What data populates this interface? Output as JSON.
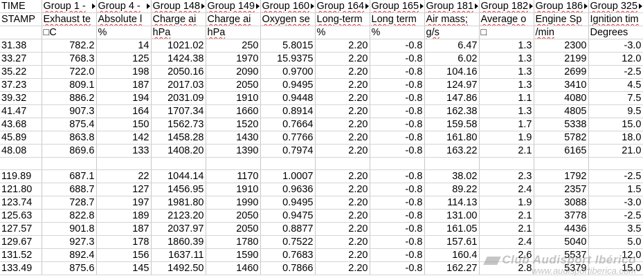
{
  "sheet": {
    "header_row1": [
      "TIME",
      "Group 1 -",
      "Group 4 -",
      "Group 148",
      "Group 149",
      "Group 160",
      "Group 164",
      "Group 165",
      "Group 181",
      "Group 182",
      "Group 186",
      "Group 325"
    ],
    "header_row2": [
      "STAMP",
      "Exhaust te",
      "Absolute l",
      "Charge ai",
      "Charge ai",
      "Oxygen se",
      "Long-term",
      "Long term",
      "Air mass;",
      "Average o",
      "Engine Sp",
      "Ignition tim"
    ],
    "units_row": [
      "",
      "□C",
      "%",
      "hPa",
      "hPa",
      "",
      "%",
      "%",
      "g/s",
      "□",
      "/min",
      "Degrees"
    ],
    "rows": [
      [
        "31.38",
        "782.2",
        "14",
        "1021.02",
        "250",
        "5.8015",
        "2.20",
        "-0.8",
        "6.47",
        "1.3",
        "2300",
        "-3.0"
      ],
      [
        "33.27",
        "768.3",
        "125",
        "1424.38",
        "1970",
        "15.9375",
        "2.20",
        "-0.8",
        "6.02",
        "1.3",
        "2199",
        "12.0"
      ],
      [
        "35.22",
        "722.0",
        "198",
        "2050.16",
        "2090",
        "0.9700",
        "2.20",
        "-0.8",
        "104.16",
        "1.3",
        "2699",
        "-2.5"
      ],
      [
        "37.23",
        "809.1",
        "187",
        "2017.03",
        "2050",
        "0.9495",
        "2.20",
        "-0.8",
        "124.97",
        "1.3",
        "3410",
        "4.5"
      ],
      [
        "39.32",
        "886.2",
        "194",
        "2031.09",
        "1910",
        "0.9448",
        "2.20",
        "-0.8",
        "147.86",
        "1.1",
        "4080",
        "7.5"
      ],
      [
        "41.47",
        "907.3",
        "164",
        "1707.34",
        "1660",
        "0.8914",
        "2.20",
        "-0.8",
        "162.38",
        "1.3",
        "4805",
        "9.5"
      ],
      [
        "43.68",
        "875.4",
        "150",
        "1562.73",
        "1520",
        "0.7664",
        "2.20",
        "-0.8",
        "159.58",
        "1.7",
        "5338",
        "15.0"
      ],
      [
        "45.89",
        "863.8",
        "142",
        "1458.28",
        "1430",
        "0.7766",
        "2.20",
        "-0.8",
        "161.80",
        "1.9",
        "5782",
        "18.0"
      ],
      [
        "48.08",
        "869.6",
        "133",
        "1408.20",
        "1390",
        "0.7974",
        "2.20",
        "-0.8",
        "163.22",
        "2.1",
        "6165",
        "21.0"
      ],
      [
        "",
        "",
        "",
        "",
        "",
        "",
        "",
        "",
        "",
        "",
        "",
        ""
      ],
      [
        "119.89",
        "687.1",
        "22",
        "1044.14",
        "1170",
        "1.0007",
        "2.20",
        "-0.8",
        "38.02",
        "2.3",
        "1792",
        "-2.5"
      ],
      [
        "121.80",
        "688.7",
        "127",
        "1456.95",
        "1910",
        "0.9636",
        "2.20",
        "-0.8",
        "89.22",
        "2.4",
        "2357",
        "1.5"
      ],
      [
        "123.74",
        "728.7",
        "197",
        "1981.80",
        "1990",
        "0.9495",
        "2.20",
        "-0.8",
        "114.13",
        "1.9",
        "3088",
        "-3.0"
      ],
      [
        "125.63",
        "822.8",
        "189",
        "2123.20",
        "2050",
        "0.9475",
        "2.20",
        "-0.8",
        "131.00",
        "2.1",
        "3778",
        "-2.5"
      ],
      [
        "127.57",
        "901.8",
        "187",
        "2037.97",
        "2050",
        "0.8877",
        "2.20",
        "-0.8",
        "161.05",
        "2.1",
        "4436",
        "3.5"
      ],
      [
        "129.67",
        "927.3",
        "178",
        "1860.39",
        "1780",
        "0.7522",
        "2.20",
        "-0.8",
        "157.61",
        "2.4",
        "5040",
        "5.0"
      ],
      [
        "131.52",
        "892.4",
        "156",
        "1637.11",
        "1590",
        "0.7683",
        "2.20",
        "-0.8",
        "160.4",
        "2.6",
        "5537",
        "12.0"
      ],
      [
        "133.49",
        "875.6",
        "145",
        "1492.50",
        "1460",
        "0.7866",
        "2.20",
        "-0.8",
        "162.27",
        "2.8",
        "5379",
        "15.0"
      ]
    ]
  },
  "watermark": {
    "line1": "Club Audisport Ibérico",
    "line2": "www.audisportiberica.com"
  }
}
